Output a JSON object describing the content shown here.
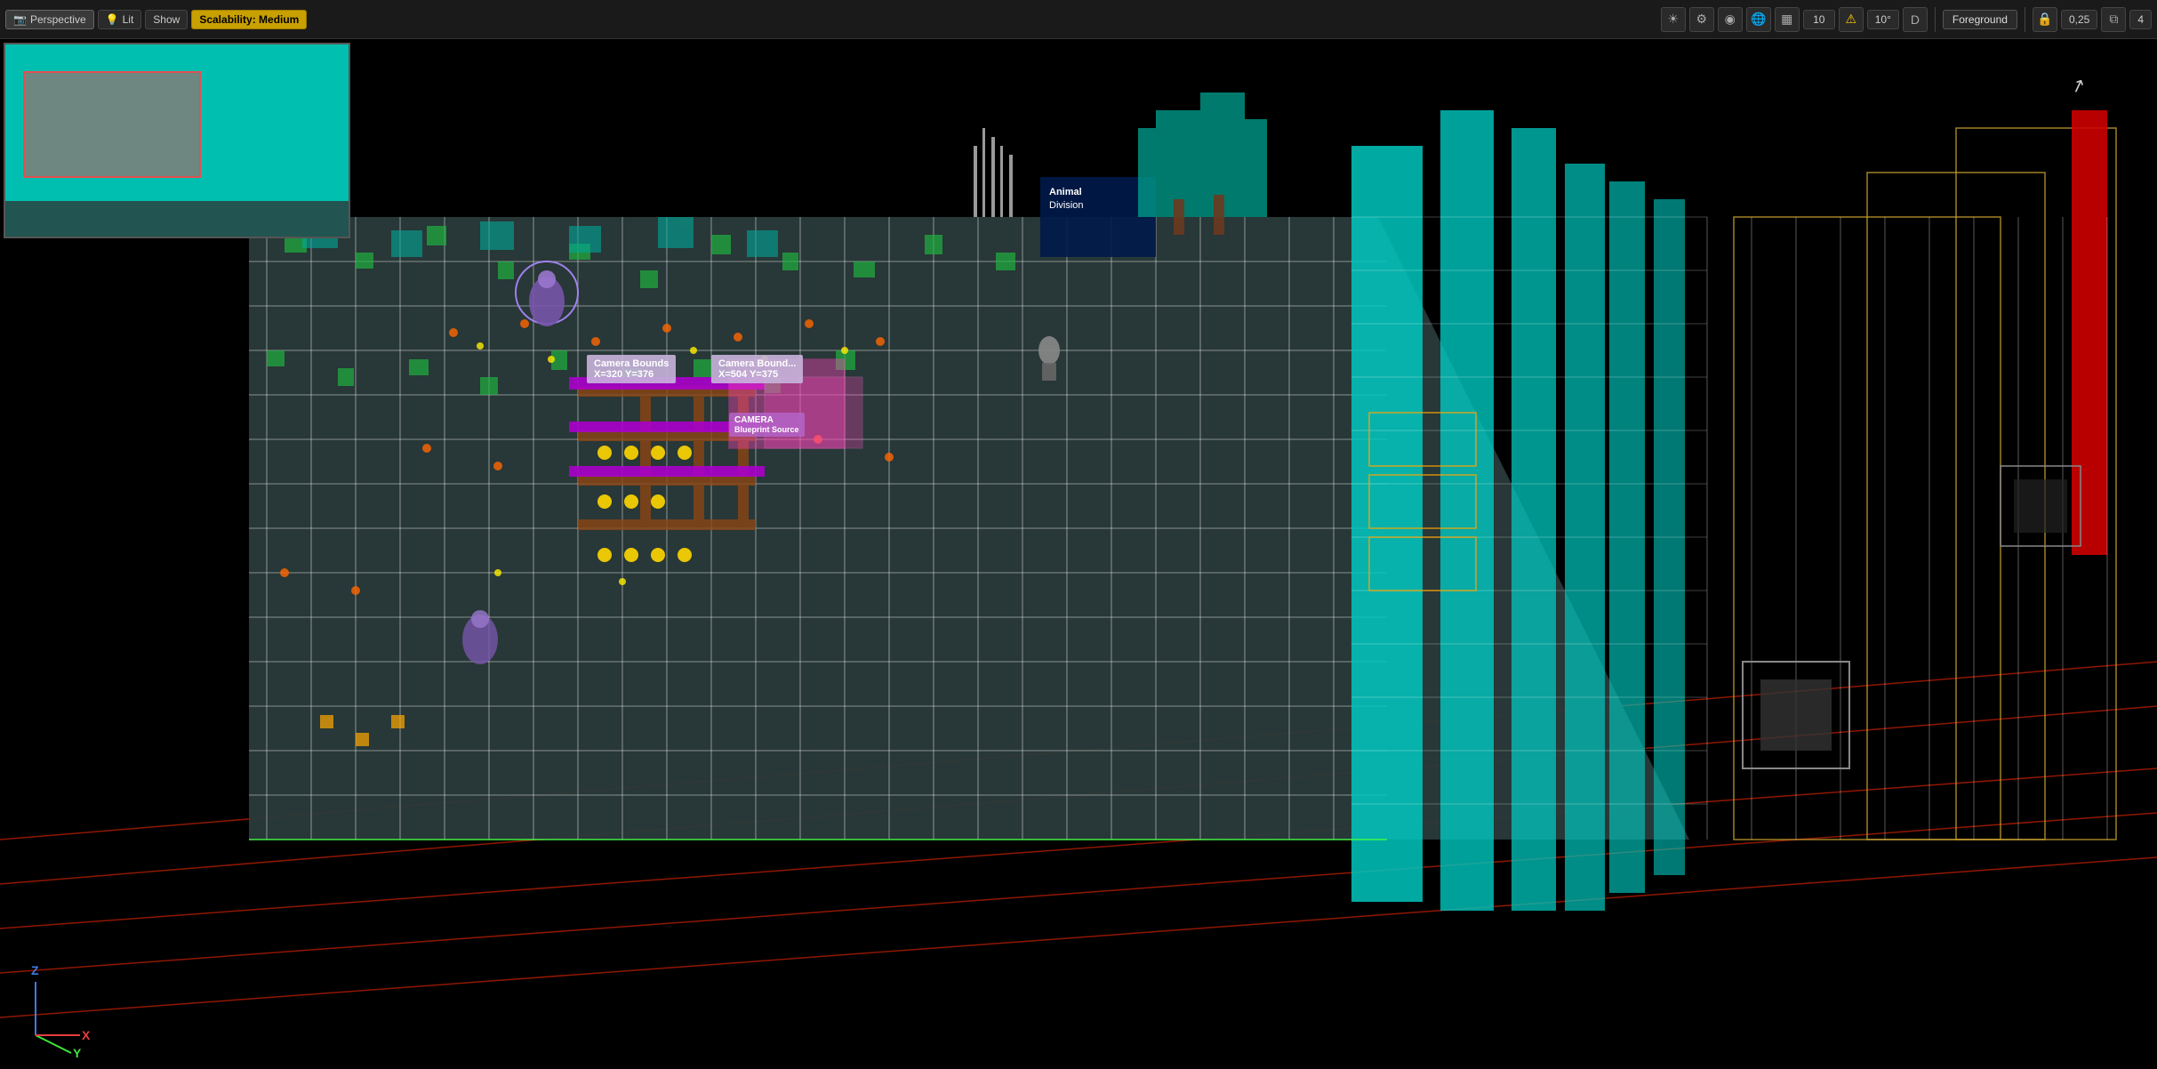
{
  "toolbar": {
    "left": {
      "perspective_label": "Perspective",
      "lit_label": "Lit",
      "show_label": "Show",
      "scalability_label": "Scalability: Medium"
    },
    "right": {
      "icons": [
        "☀",
        "⚙",
        "◉",
        "🌐",
        "▦",
        "10",
        "⚠",
        "10°",
        "D",
        "Foreground",
        "0,25",
        "4"
      ],
      "foreground_label": "Foreground",
      "value1": "0,25",
      "value2": "4",
      "grid_value": "10",
      "angle_value": "10°"
    }
  },
  "viewport": {
    "camera_label_1": "Camera Bounds",
    "camera_coords_1": "X=320 Y=376",
    "camera_label_2": "Camera Bound...",
    "camera_coords_2": "X=504 Y=375",
    "camera_label_3": "CAMERA",
    "camera_sublabel": "Blueprint Source",
    "axis": {
      "x_label": "X",
      "y_label": "Y",
      "z_label": "Z"
    }
  },
  "icons": {
    "perspective_icon": "📷",
    "lit_icon": "💡",
    "cursor_arrow": "↗"
  }
}
